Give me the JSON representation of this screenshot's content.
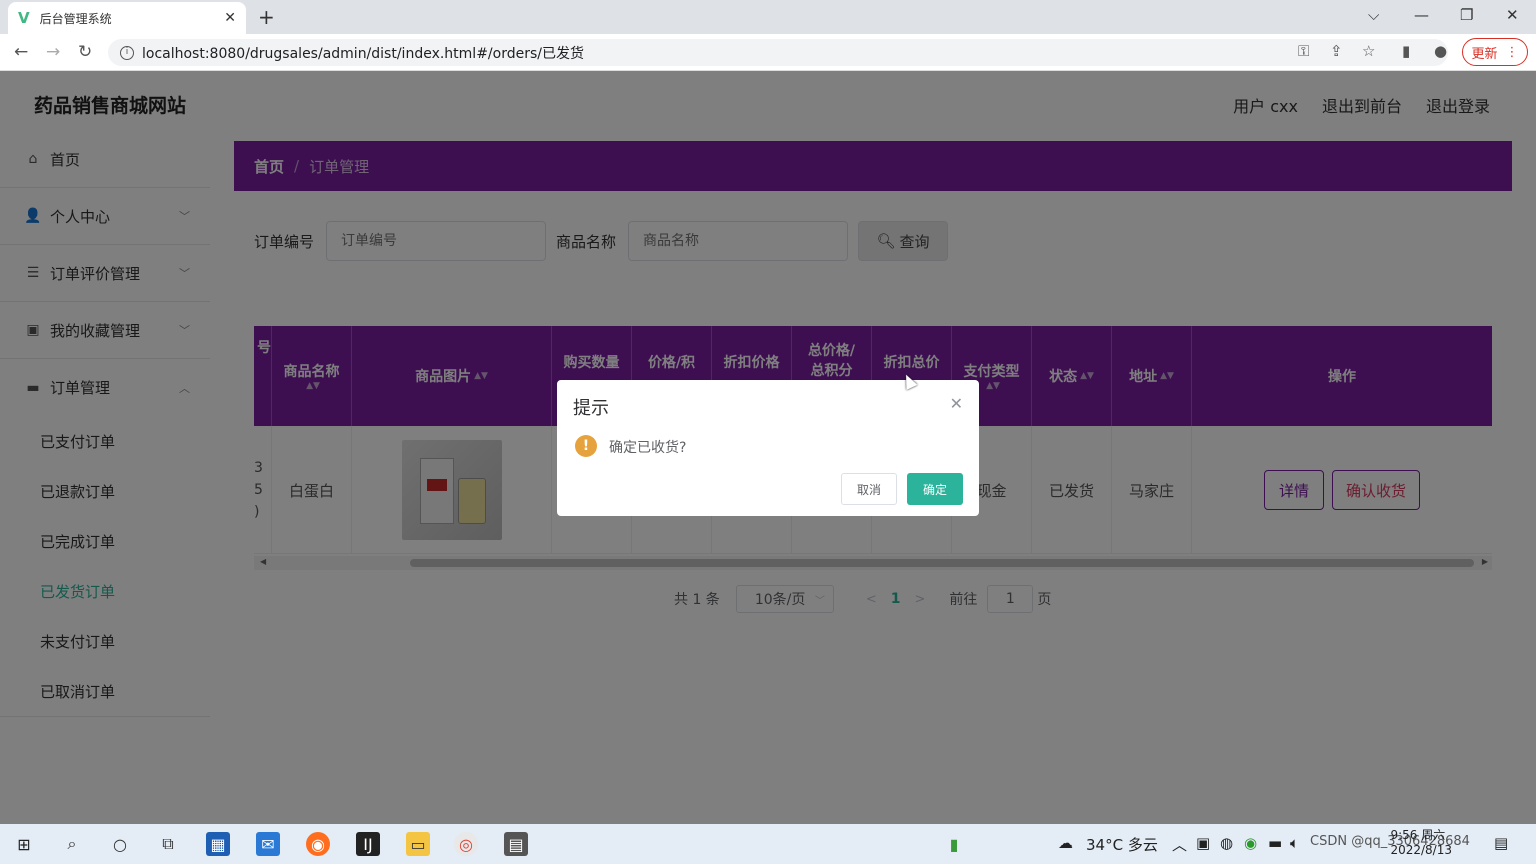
{
  "browser": {
    "tab_title": "后台管理系统",
    "tab_close": "✕",
    "new_tab": "+",
    "url": "localhost:8080/drugsales/admin/dist/index.html#/orders/已发货",
    "update_label": "更新"
  },
  "header": {
    "site_title": "药品销售商城网站",
    "user_label": "用户 cxx",
    "back_to_front": "退出到前台",
    "logout": "退出登录"
  },
  "sidebar": {
    "home": "首页",
    "personal_center": "个人中心",
    "order_review": "订单评价管理",
    "favorites": "我的收藏管理",
    "order_mgmt": "订单管理",
    "sub_items": [
      "已支付订单",
      "已退款订单",
      "已完成订单",
      "已发货订单",
      "未支付订单",
      "已取消订单"
    ]
  },
  "breadcrumb": {
    "home": "首页",
    "separator": "/",
    "current": "订单管理"
  },
  "search": {
    "order_no_label": "订单编号",
    "order_no_placeholder": "订单编号",
    "product_name_label": "商品名称",
    "product_name_placeholder": "商品名称",
    "query_label": "查询"
  },
  "table": {
    "headers": {
      "h0": "号",
      "h1": "商品名称",
      "h2": "商品图片",
      "h3": "购买数量",
      "h4": "价格/积",
      "h5": "折扣价格",
      "h6a": "总价格/",
      "h6b": "总积分",
      "h7": "折扣总价",
      "h8": "支付类型",
      "h9": "状态",
      "h10": "地址",
      "h11": "操作"
    },
    "row": {
      "c0a": "3",
      "c0b": "5",
      "c0c": ")",
      "product_name": "白蛋白",
      "pay_type": "现金",
      "status": "已发货",
      "address": "马家庄",
      "detail_btn": "详情",
      "confirm_btn": "确认收货"
    }
  },
  "pager": {
    "total": "共 1 条",
    "page_size": "10条/页",
    "current_page": "1",
    "goto_prefix": "前往",
    "goto_value": "1",
    "goto_suffix": "页"
  },
  "dialog": {
    "title": "提示",
    "message": "确定已收货?",
    "cancel": "取消",
    "confirm": "确定"
  },
  "taskbar": {
    "weather": "34°C  多云",
    "time": "9:56 周六",
    "date": "2022/8/13",
    "watermark": "CSDN @qq_3306428684"
  },
  "colors": {
    "accent_purple": "#7a1fa2",
    "accent_teal": "#2bb39b",
    "warning": "#e6a23c"
  }
}
